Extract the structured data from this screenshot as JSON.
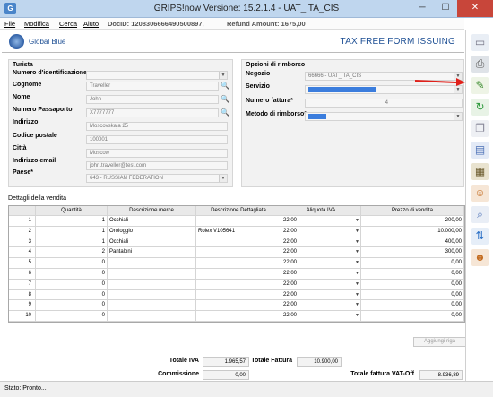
{
  "window": {
    "title": "GRIPS!now Versione: 15.2.1.4 - UAT_ITA_CIS",
    "icon": "grips-app-icon",
    "min": "─",
    "max": "☐",
    "close": "✕"
  },
  "menu": {
    "file": "File",
    "modifica": "Modifica",
    "cerca": "Cerca",
    "aiuto": "Aiuto",
    "doc_id": "DocID: 12083066664905008​97,",
    "refund": "Refund Amount: 1675,00"
  },
  "header": {
    "brand": "Global Blue",
    "heading": "TAX FREE FORM ISSUING"
  },
  "turista": {
    "section": "Turista",
    "id_label": "Numero d'identificazione",
    "cognome_label": "Cognome",
    "cognome": "Traveller",
    "nome_label": "Nome",
    "nome": "John",
    "passaporto_label": "Numero Passaporto",
    "passaporto": "X7777777",
    "indirizzo_label": "Indirizzo",
    "indirizzo": "Moscovskaja 25",
    "cap_label": "Codice postale",
    "cap": "100001",
    "citta_label": "Città",
    "citta": "Moscow",
    "email_label": "Indirizzo email",
    "email": "john.traveller@test.com",
    "paese_label": "Paese*",
    "paese": "643 - RUSSIAN FEDERATION"
  },
  "rimborso": {
    "section": "Opzioni di rimborso",
    "negozio_label": "Negozio",
    "negozio": "66666 - UAT_ITA_CIS",
    "servizio_label": "Servizio",
    "fattura_label": "Numero fattura*",
    "fattura": "4",
    "metodo_label": "Metodo di rimborso*"
  },
  "dettagli": {
    "section": "Dettagli della vendita",
    "columns": [
      "",
      "Quantità",
      "Descrizione merce",
      "Descrizione Dettagliata",
      "Aliquota IVA",
      "Prezzo di vendita"
    ],
    "rows": [
      [
        "1",
        "1",
        "Occhiali",
        "",
        "22,00",
        "200,00"
      ],
      [
        "2",
        "1",
        "Orologgio",
        "Rolex V105641",
        "22,00",
        "10.000,00"
      ],
      [
        "3",
        "1",
        "Occhiali",
        "",
        "22,00",
        "400,00"
      ],
      [
        "4",
        "2",
        "Pantaloni",
        "",
        "22,00",
        "300,00"
      ],
      [
        "5",
        "0",
        "",
        "",
        "22,00",
        "0,00"
      ],
      [
        "6",
        "0",
        "",
        "",
        "22,00",
        "0,00"
      ],
      [
        "7",
        "0",
        "",
        "",
        "22,00",
        "0,00"
      ],
      [
        "8",
        "0",
        "",
        "",
        "22,00",
        "0,00"
      ],
      [
        "9",
        "0",
        "",
        "",
        "22,00",
        "0,00"
      ],
      [
        "10",
        "0",
        "",
        "",
        "22,00",
        "0,00"
      ]
    ],
    "add_row": "Aggiungi riga"
  },
  "totals": {
    "iva_label": "Totale IVA",
    "iva": "1.965,57",
    "fattura_label": "Totale Fattura",
    "fattura": "10.900,00",
    "commissione_label": "Commissione",
    "commissione": "0,00",
    "vatoff_label": "Totale fattura VAT-Off",
    "vatoff": "8.936,89"
  },
  "status": {
    "text": "Stato: Pronto..."
  },
  "toolbar_icons": [
    "new-document-icon",
    "printer-icon",
    "edit-icon",
    "refresh-icon",
    "copy-icon",
    "documents-icon",
    "cash-icon",
    "user-icon",
    "search-document-icon",
    "sync-icon",
    "user-add-icon"
  ]
}
